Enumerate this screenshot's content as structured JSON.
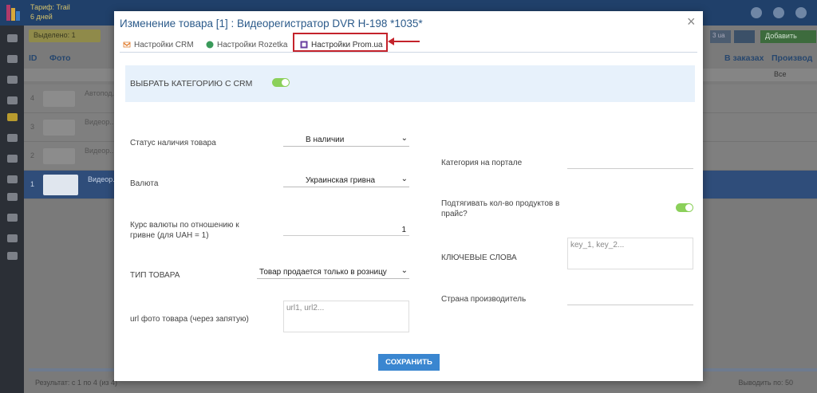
{
  "background": {
    "brand_line1": "Тариф: Trail",
    "brand_line2": "6 дней",
    "toolbar_left_label": "Выделено: 1",
    "toolbar_right_label": "Добавить",
    "toolbar_small_label": "3 ua",
    "columns": [
      "ID",
      "Фото",
      "В заказах",
      "Производ"
    ],
    "filter_value": "Все",
    "rows": [
      {
        "id": "4",
        "name": "Автопод..."
      },
      {
        "id": "3",
        "name": "Видеор..."
      },
      {
        "id": "2",
        "name": "Видеор..."
      },
      {
        "id": "1",
        "name": "Видеор..."
      }
    ],
    "footer_left": "Результат: с 1 по 4 (из 4)",
    "footer_right": "Выводить по: 50"
  },
  "modal": {
    "title": "Изменение товара [1] : Видеорегистратор DVR H-198 *1035*",
    "close_symbol": "×",
    "tabs": [
      {
        "label": "Настройки CRM",
        "icon": "crm-icon"
      },
      {
        "label": "Настройки Rozetka",
        "icon": "rozetka-icon"
      },
      {
        "label": "Настройки Prom.ua",
        "icon": "prom-icon"
      }
    ],
    "active_tab": "Настройки Prom.ua",
    "category_toggle_label": "ВЫБРАТЬ КАТЕГОРИЮ С CRM",
    "category_toggle_on": true,
    "fields": {
      "availability": {
        "label": "Статус наличия товара",
        "value": "В наличии"
      },
      "currency": {
        "label": "Валюта",
        "value": "Украинская гривна"
      },
      "rate": {
        "label": "Курс валюты по отношению к гривне (для UAH = 1)",
        "value": "1"
      },
      "product_type": {
        "label": "ТИП ТОВАРА",
        "value": "Товар продается только в розницу"
      },
      "photo_url": {
        "label": "url фото товара (через запятую)",
        "placeholder": "url1, url2..."
      },
      "portal_category": {
        "label": "Категория на портале",
        "value": ""
      },
      "pull_qty": {
        "label": "Подтягивать кол-во продуктов в прайс?",
        "on": true
      },
      "keywords": {
        "label": "КЛЮЧЕВЫЕ СЛОВА",
        "placeholder": "key_1, key_2..."
      },
      "country": {
        "label": "Страна производитель",
        "value": ""
      }
    },
    "save_label": "СОХРАНИТЬ"
  },
  "colors": {
    "accent": "#3a86d0",
    "title": "#2b5a8a",
    "toggle_on": "#8bd05a",
    "highlight": "#c4232b"
  }
}
